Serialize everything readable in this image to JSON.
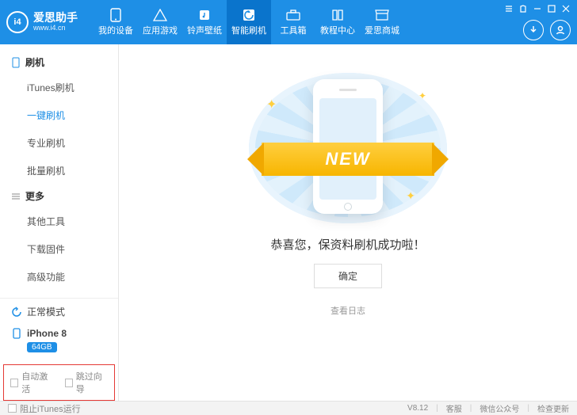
{
  "brand": {
    "logo_text": "i4",
    "cn": "爱思助手",
    "en": "www.i4.cn"
  },
  "nav": {
    "items": [
      {
        "label": "我的设备"
      },
      {
        "label": "应用游戏"
      },
      {
        "label": "铃声壁纸"
      },
      {
        "label": "智能刷机"
      },
      {
        "label": "工具箱"
      },
      {
        "label": "教程中心"
      },
      {
        "label": "爱思商城"
      }
    ]
  },
  "sidebar": {
    "group1": {
      "title": "刷机",
      "items": [
        "iTunes刷机",
        "一键刷机",
        "专业刷机",
        "批量刷机"
      ]
    },
    "group2": {
      "title": "更多",
      "items": [
        "其他工具",
        "下载固件",
        "高级功能"
      ]
    },
    "mode": "正常模式",
    "device": "iPhone 8",
    "storage": "64GB",
    "opt_auto": "自动激活",
    "opt_skip": "跳过向导"
  },
  "content": {
    "ribbon": "NEW",
    "success": "恭喜您，保资料刷机成功啦！",
    "confirm": "确定",
    "view_log": "查看日志"
  },
  "footer": {
    "block_itunes": "阻止iTunes运行",
    "version": "V8.12",
    "links": [
      "客服",
      "微信公众号",
      "检查更新"
    ]
  },
  "accent": "#1e8fe6"
}
